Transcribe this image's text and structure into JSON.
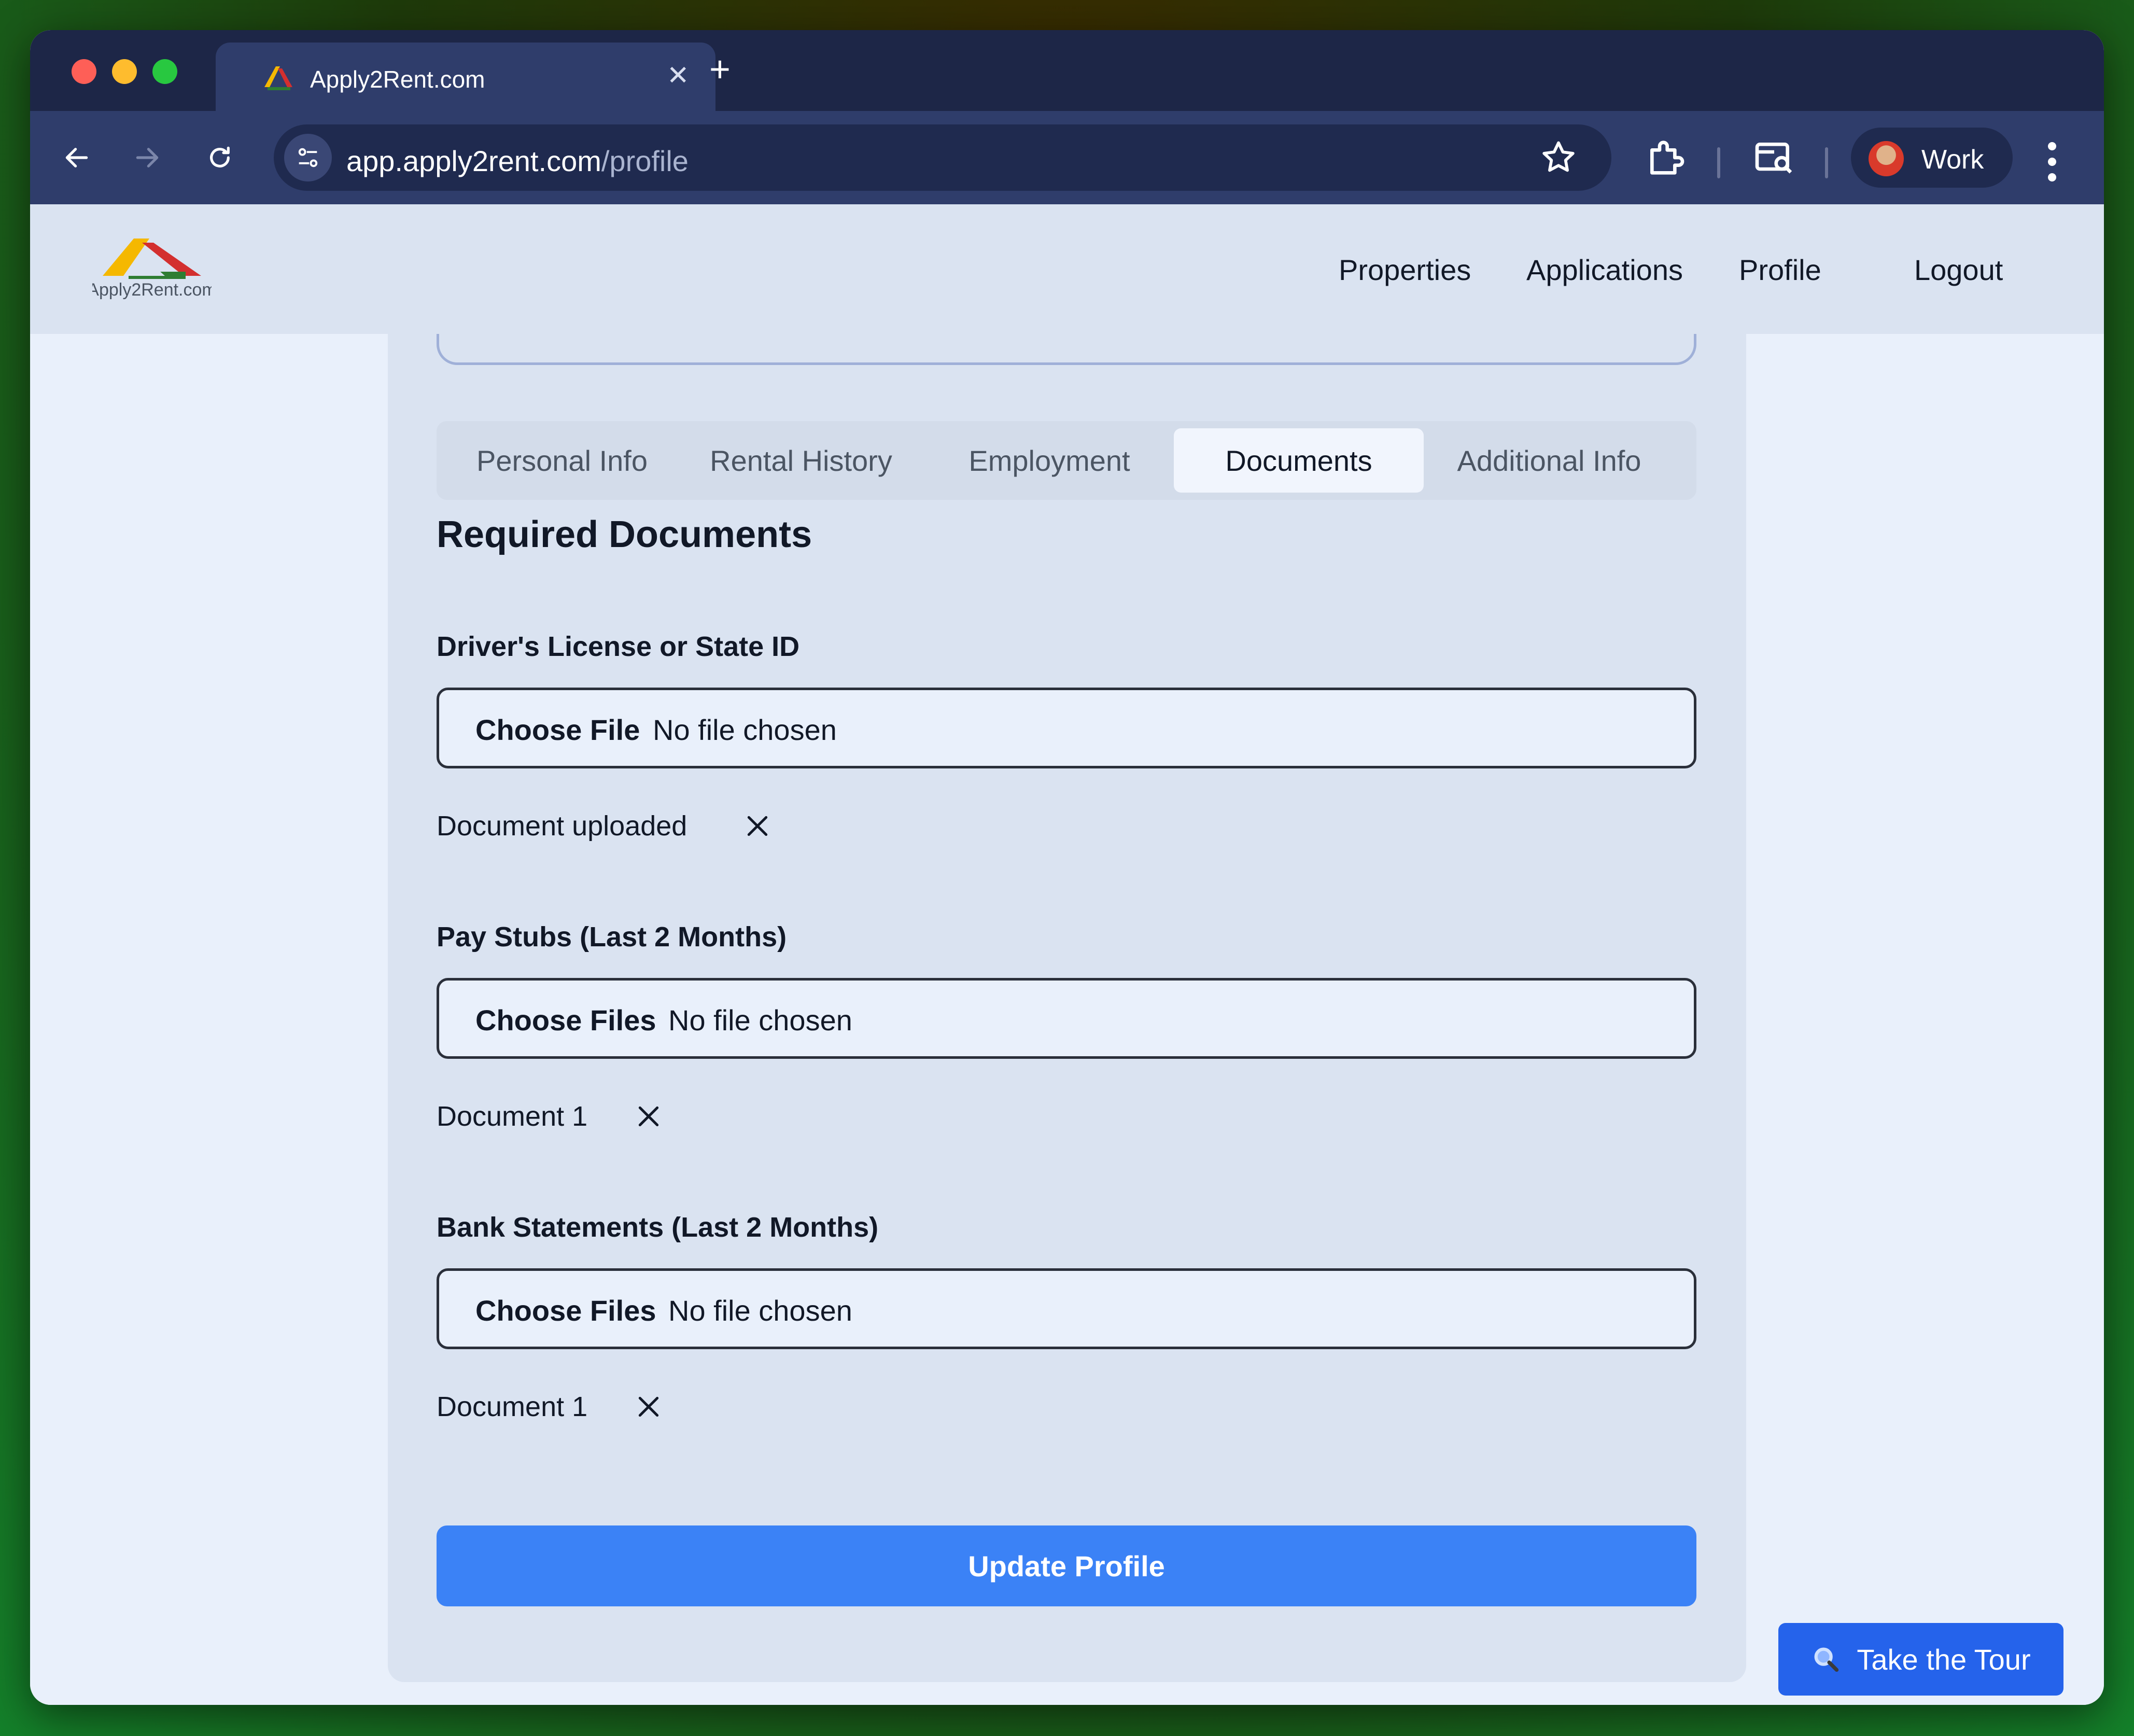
{
  "browser": {
    "tab_title": "Apply2Rent.com",
    "url_host": "app.apply2rent.com",
    "url_path": "/profile",
    "profile_name": "Work"
  },
  "nav": {
    "links": [
      "Properties",
      "Applications",
      "Profile",
      "Logout"
    ]
  },
  "tabs": [
    {
      "label": "Personal Info",
      "active": false
    },
    {
      "label": "Rental History",
      "active": false
    },
    {
      "label": "Employment",
      "active": false
    },
    {
      "label": "Documents",
      "active": true
    },
    {
      "label": "Additional Info",
      "active": false
    }
  ],
  "section_title": "Required Documents",
  "documents": [
    {
      "label": "Driver's License or State ID",
      "button": "Choose File",
      "status": "No file chosen",
      "uploaded": "Document uploaded"
    },
    {
      "label": "Pay Stubs (Last 2 Months)",
      "button": "Choose Files",
      "status": "No file chosen",
      "uploaded": "Document 1"
    },
    {
      "label": "Bank Statements (Last 2 Months)",
      "button": "Choose Files",
      "status": "No file chosen",
      "uploaded": "Document 1"
    }
  ],
  "update_button": "Update Profile",
  "tour_button": "Take the Tour",
  "colors": {
    "primary": "#3b82f6",
    "tour": "#2563eb",
    "browser_frame": "#2f3d6b"
  }
}
